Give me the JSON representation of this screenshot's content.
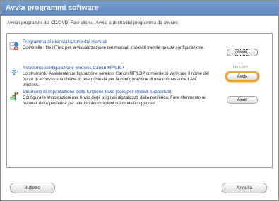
{
  "window": {
    "title": "Avvia programmi software",
    "instruction": "Avvia i programmi dal CD/DVD. Fare clic su [Avvia] a destra del programma da avviare."
  },
  "programs": [
    {
      "title": "Programma di disinstallazione dei manuali",
      "description": "Disinstalla i file HTML per la visualizzazione dei manuali installati tramite questa configurazione.",
      "status": "",
      "button_label": "Avvia",
      "icon": "uninstall-manual-icon"
    },
    {
      "title": "Assistente configurazione wireless Canon MF/LBP",
      "description": "Lo strumento Assistente configurazione wireless Canon MF/LBP consente di verificare il nome del punto di accesso e la chiave di rete richiesta per la configurazione di una connessione LAN wireless.",
      "status": "Lanciare",
      "button_label": "Avvia",
      "icon": "wireless-setup-icon"
    },
    {
      "title": "Strumenti di impostazione della funzione Invio (solo per modelli supportati)",
      "description": "Configura le impostazioni per l'invio degli originali digitalizzati dalla periferica. Fare riferimento ai manuali della periferica per ulteriori informazioni sui modelli supportati.",
      "status": "",
      "button_label": "Avvia",
      "icon": "send-function-icon"
    }
  ],
  "footer": {
    "back_label": "Indietro",
    "cancel_label": "Annulla"
  },
  "colors": {
    "title_bar": "#6b91c6",
    "link_text": "#2050a8",
    "focus_ring": "#f0a32a"
  }
}
